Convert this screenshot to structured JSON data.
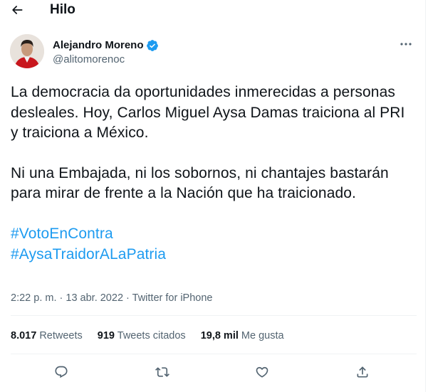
{
  "header": {
    "title": "Hilo",
    "back_icon": "arrow-left-icon"
  },
  "author": {
    "name": "Alejandro Moreno",
    "handle": "@alitomorenoc",
    "verified_icon": "verified-badge-icon",
    "more_icon": "more-horizontal-icon"
  },
  "tweet": {
    "paragraphs": [
      "La democracia da oportunidades inmerecidas a personas desleales. Hoy, Carlos Miguel Aysa Damas traiciona al PRI y traiciona a México.",
      "Ni una Embajada, ni los sobornos, ni chantajes bastarán para mirar de frente a la Nación que ha traicionado."
    ],
    "hashtags": [
      "#VotoEnContra",
      "#AysaTraidorALaPatria"
    ],
    "time": "2:22 p. m.",
    "date": "13 abr. 2022",
    "source": "Twitter for iPhone",
    "separator": "·"
  },
  "stats": {
    "retweets_count": "8.017",
    "retweets_label": "Retweets",
    "quotes_count": "919",
    "quotes_label": "Tweets citados",
    "likes_count": "19,8 mil",
    "likes_label": "Me gusta"
  },
  "actions": {
    "reply_icon": "reply-icon",
    "retweet_icon": "retweet-icon",
    "like_icon": "heart-icon",
    "share_icon": "share-icon"
  },
  "colors": {
    "accent": "#1d9bf0",
    "text": "#0f1419",
    "secondary": "#536471",
    "divider": "#eff3f4"
  }
}
